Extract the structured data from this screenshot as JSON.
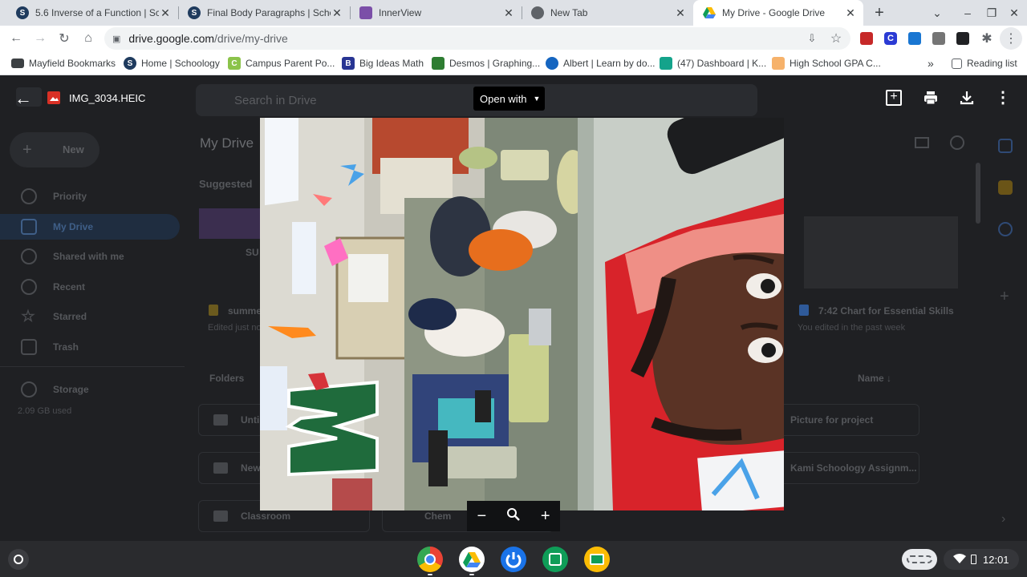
{
  "tabs": [
    {
      "title": "5.6 Inverse of a Function | Sch",
      "fav": "S",
      "fav_color": "#1f3b5e",
      "active": false
    },
    {
      "title": "Final Body Paragraphs | Schoo",
      "fav": "S",
      "fav_color": "#1f3b5e",
      "active": false
    },
    {
      "title": "InnerView",
      "fav": "",
      "fav_color": "#7b4fa8",
      "active": false
    },
    {
      "title": "New Tab",
      "fav": "",
      "fav_color": "#5f6368",
      "active": false
    },
    {
      "title": "My Drive - Google Drive",
      "fav": "",
      "fav_color": "#1a73e8",
      "active": true
    }
  ],
  "new_tab_symbol": "+",
  "url": {
    "host": "drive.google.com",
    "path": "/drive/my-drive"
  },
  "bookmarks": [
    {
      "label": "Mayfield Bookmarks",
      "fav": "",
      "fav_color": "#3c4043"
    },
    {
      "label": "Home | Schoology",
      "fav": "S",
      "fav_color": "#1f3b5e"
    },
    {
      "label": "Campus Parent Po...",
      "fav": "C",
      "fav_color": "#8bc34a"
    },
    {
      "label": "Big Ideas Math",
      "fav": "B",
      "fav_color": "#283593"
    },
    {
      "label": "Desmos | Graphing...",
      "fav": "",
      "fav_color": "#2e7d32"
    },
    {
      "label": "Albert | Learn by do...",
      "fav": "",
      "fav_color": "#1565c0"
    },
    {
      "label": "(47) Dashboard | K...",
      "fav": "",
      "fav_color": "#14a38b"
    },
    {
      "label": "High School GPA C...",
      "fav": "",
      "fav_color": "#f6b26b"
    }
  ],
  "bookmarks_overflow": "»",
  "reading_list": "Reading list",
  "drive": {
    "new_label": "New",
    "nav": [
      "Priority",
      "My Drive",
      "Shared with me",
      "Recent",
      "Starred",
      "Trash"
    ],
    "storage_label": "Storage",
    "storage_used": "2.09 GB used",
    "title": "My Drive",
    "search_placeholder": "Search in Drive",
    "suggested": "Suggested",
    "card_left_title": "summe",
    "card_left_sub": "Edited just no",
    "card_left_thumb": "SU",
    "card_right_title": "7:42 Chart for Essential Skills",
    "card_right_sub": "You edited in the past week",
    "folders_label": "Folders",
    "name_sort": "Name",
    "folders": [
      "Unti",
      "New",
      "Classroom",
      "Chem",
      "Picture for project",
      "Kami Schoology Assignm..."
    ]
  },
  "viewer": {
    "filename": "IMG_3034.HEIC",
    "open_with": "Open with",
    "zoom_out": "−",
    "zoom_in": "+"
  },
  "shelf": {
    "time": "12:01"
  }
}
